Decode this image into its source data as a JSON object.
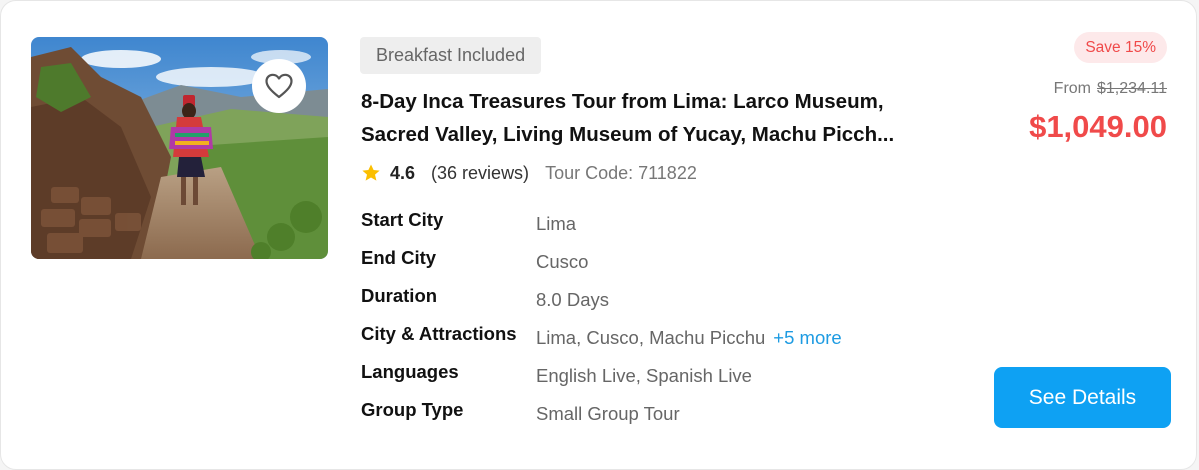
{
  "card": {
    "badge": "Breakfast Included",
    "title_line1": "8-Day Inca Treasures Tour from Lima: Larco Museum,",
    "title_line2": "Sacred Valley, Living Museum of Yucay, Machu Picch...",
    "rating": "4.6",
    "reviews": "(36 reviews)",
    "tour_code": "Tour Code: 711822",
    "details": [
      {
        "label": "Start City",
        "value": "Lima"
      },
      {
        "label": "End City",
        "value": "Cusco"
      },
      {
        "label": "Duration",
        "value": "8.0 Days"
      },
      {
        "label": "City & Attractions",
        "value": "Lima, Cusco, Machu Picchu",
        "more": "+5 more"
      },
      {
        "label": "Languages",
        "value": "English Live, Spanish Live"
      },
      {
        "label": "Group Type",
        "value": "Small Group Tour"
      }
    ],
    "save_label": "Save 15%",
    "from_label": "From",
    "original_price": "$1,234.11",
    "price": "$1,049.00",
    "cta_label": "See Details"
  },
  "icons": {
    "favorite": "heart-outline-icon",
    "rating": "star-icon"
  },
  "colors": {
    "accent": "#0ea1f3",
    "price": "#f04a4a",
    "star": "#fbbf00",
    "link": "#1d9be2"
  }
}
